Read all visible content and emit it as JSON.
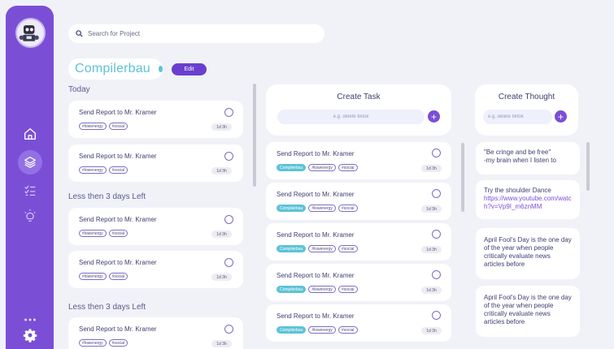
{
  "search": {
    "placeholder": "Search for Project"
  },
  "project": {
    "name": "Compilerbau",
    "edit_label": "Edit"
  },
  "sections": {
    "today": "Today",
    "less_than_3_days_1": "Less then 3 days Left",
    "less_than_3_days_2": "Less then 3 days Left"
  },
  "task_template": {
    "title": "Send Report to Mr. Kramer",
    "tag1": "#lowenergy",
    "tag2": "#social",
    "project_tag": "Compilerbau",
    "time": "1d 3h"
  },
  "left_tasks": [
    {
      "title": "Send Report to Mr. Kramer",
      "tags": [
        "#lowenergy",
        "#social"
      ],
      "time": "1d 3h"
    },
    {
      "title": "Send Report to Mr. Kramer",
      "tags": [
        "#lowenergy",
        "#social"
      ],
      "time": "1d 3h"
    },
    {
      "title": "Send Report to Mr. Kramer",
      "tags": [
        "#lowenergy",
        "#social"
      ],
      "time": "1d 3h"
    },
    {
      "title": "Send Report to Mr. Kramer",
      "tags": [
        "#lowenergy",
        "#social"
      ],
      "time": "1d 3h"
    },
    {
      "title": "Send Report to Mr. Kramer",
      "tags": [
        "#lowenergy",
        "#social"
      ],
      "time": "1d 3h"
    }
  ],
  "create_task": {
    "title": "Create Task",
    "placeholder": "e.g. delete tiktok",
    "add_icon": "plus-icon"
  },
  "middle_tasks": [
    {
      "title": "Send Report to Mr. Kramer",
      "project": "Compilerbau",
      "tags": [
        "#lowenergy",
        "#social"
      ],
      "time": "1d 3h"
    },
    {
      "title": "Send Report to Mr. Kramer",
      "project": "Compilerbau",
      "tags": [
        "#lowenergy",
        "#social"
      ],
      "time": "1d 3h"
    },
    {
      "title": "Send Report to Mr. Kramer",
      "project": "Compilerbau",
      "tags": [
        "#lowenergy",
        "#social"
      ],
      "time": "1d 3h"
    },
    {
      "title": "Send Report to Mr. Kramer",
      "project": "Compilerbau",
      "tags": [
        "#lowenergy",
        "#social"
      ],
      "time": "1d 3h"
    },
    {
      "title": "Send Report to Mr. Kramer",
      "project": "Compilerbau",
      "tags": [
        "#lowenergy",
        "#social"
      ],
      "time": "1d 3h"
    }
  ],
  "create_thought": {
    "title": "Create Thought",
    "placeholder": "e.g. delete tiktok",
    "add_icon": "plus-icon"
  },
  "thoughts": {
    "t1_line1": "\"Be cringe and be free\"",
    "t1_line2": "-my brain when I listen to",
    "t2_text": "Try the shoulder Dance",
    "t2_link": "https://www.youtube.com/watch?v=Vp9I_m6znMM",
    "t3_text": "April Fool's Day is the one day of the year when people critically evaluate news articles before",
    "t4_text": "April Fool's Day is the one day of the year when people critically evaluate news articles before"
  },
  "sidebar": {
    "icons": [
      "avatar",
      "home-icon",
      "layers-icon",
      "checklist-icon",
      "lightbulb-icon",
      "more-icon",
      "gear-icon"
    ]
  },
  "colors": {
    "sidebar": "#7a4fd6",
    "accent": "#6a3fcf",
    "project": "#5cc3d6",
    "background": "#f1f2f8"
  }
}
